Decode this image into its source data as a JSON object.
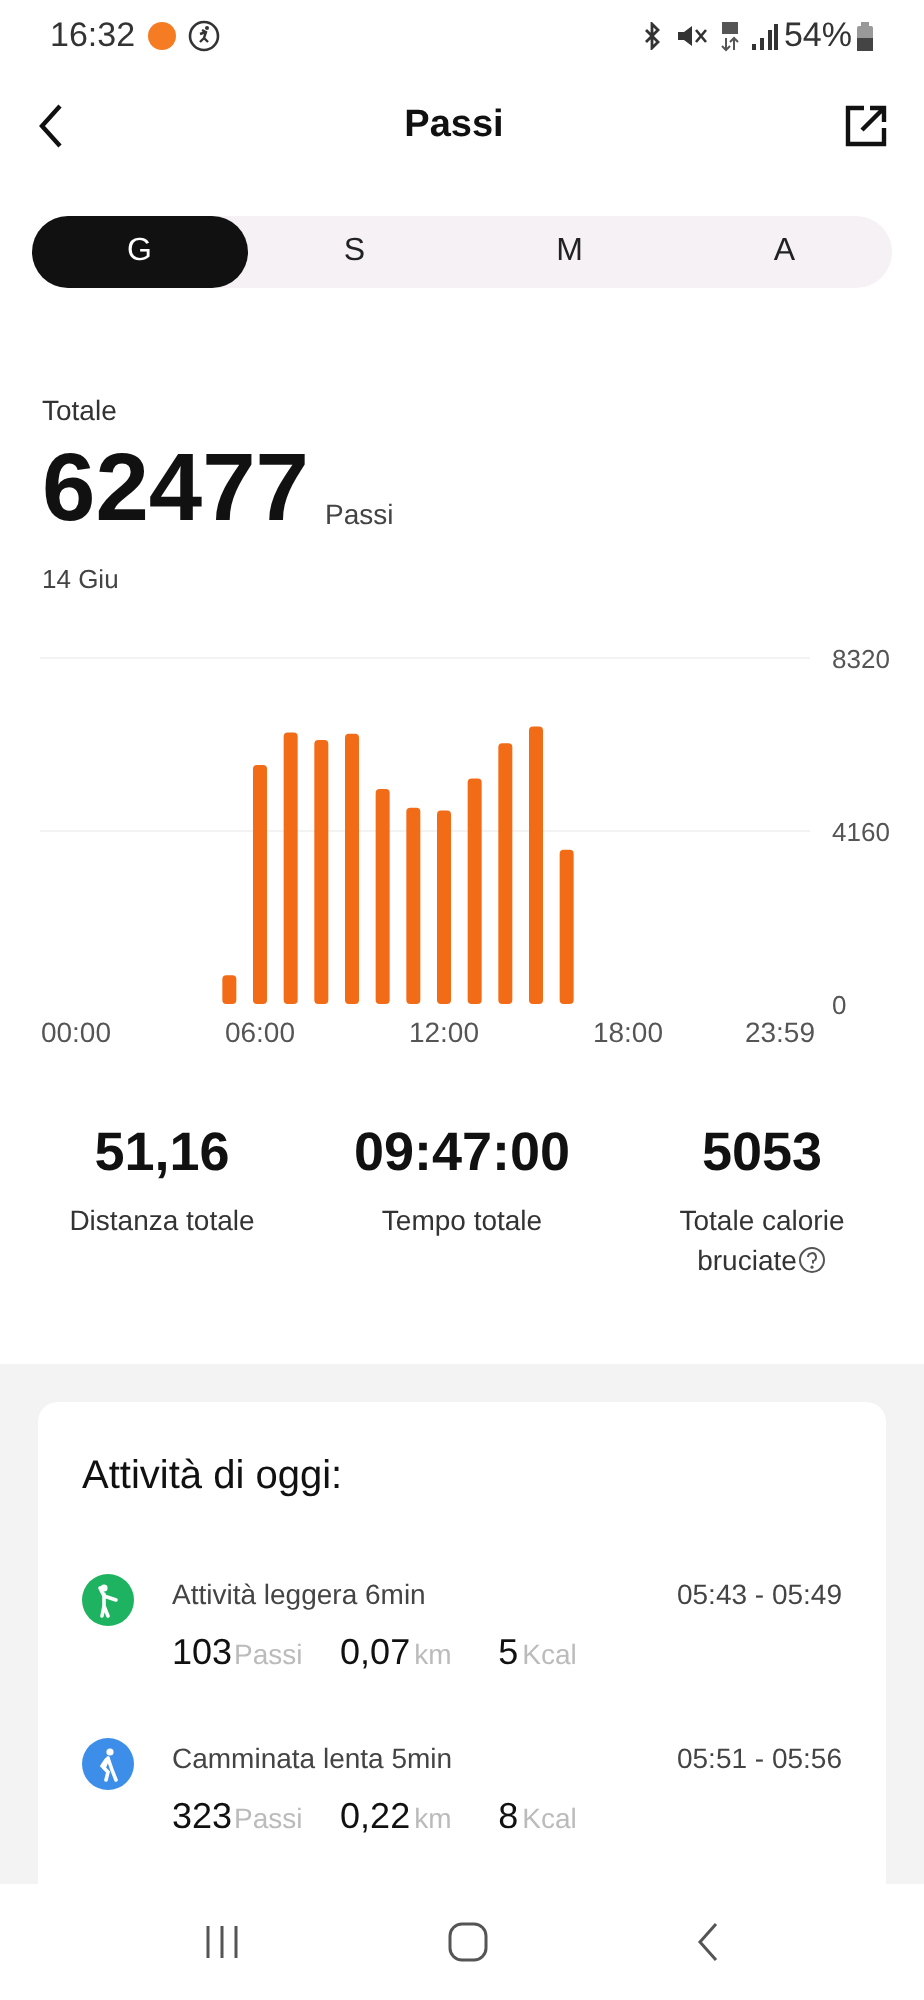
{
  "status_bar": {
    "time": "16:32",
    "battery": "54%"
  },
  "header": {
    "title": "Passi"
  },
  "tabs": [
    {
      "label": "G",
      "selected": true
    },
    {
      "label": "S",
      "selected": false
    },
    {
      "label": "M",
      "selected": false
    },
    {
      "label": "A",
      "selected": false
    }
  ],
  "summary": {
    "label": "Totale",
    "value": "62477",
    "unit": "Passi",
    "date": "14 Giu"
  },
  "chart_data": {
    "type": "bar",
    "x": [
      5,
      6,
      7,
      8,
      9,
      10,
      11,
      12,
      13,
      14,
      15,
      16
    ],
    "series": [
      {
        "color": "#f26b16",
        "values": [
          690,
          5750,
          6530,
          6350,
          6500,
          5170,
          4720,
          4650,
          5420,
          6270,
          6670,
          3710
        ]
      }
    ],
    "xlim": [
      0,
      24
    ],
    "ylim": [
      0,
      8320
    ],
    "xticks": [
      {
        "value": 0,
        "label": "00:00"
      },
      {
        "value": 6,
        "label": "06:00"
      },
      {
        "value": 12,
        "label": "12:00"
      },
      {
        "value": 18,
        "label": "18:00"
      },
      {
        "value": 23.98,
        "label": "23:59"
      }
    ],
    "yticks": [
      0,
      4160,
      8320
    ]
  },
  "stats": [
    {
      "value": "51,16",
      "label": "Distanza totale"
    },
    {
      "value": "09:47:00",
      "label": "Tempo totale"
    },
    {
      "value": "5053",
      "label": "Totale calorie bruciate",
      "help": true
    }
  ],
  "activities_title": "Attività di oggi:",
  "activities": [
    {
      "kind": "light",
      "color": "#1db360",
      "name": "Attività leggera 6min",
      "time": "05:43 - 05:49",
      "steps": "103",
      "steps_unit": "Passi",
      "distance": "0,07",
      "distance_unit": "km",
      "kcal": "5",
      "kcal_unit": "Kcal"
    },
    {
      "kind": "walk",
      "color": "#3d8ee8",
      "name": "Camminata lenta 5min",
      "time": "05:51 - 05:56",
      "steps": "323",
      "steps_unit": "Passi",
      "distance": "0,22",
      "distance_unit": "km",
      "kcal": "8",
      "kcal_unit": "Kcal"
    }
  ]
}
